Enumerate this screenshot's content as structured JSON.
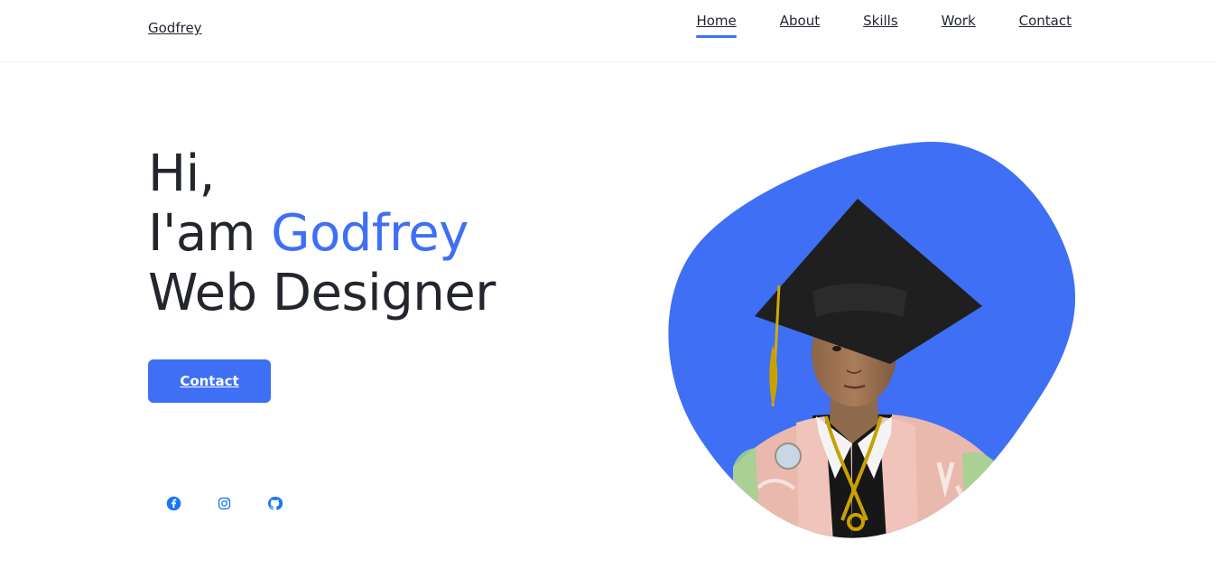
{
  "header": {
    "logo": "Godfrey",
    "nav": [
      {
        "label": "Home",
        "active": true
      },
      {
        "label": "About",
        "active": false
      },
      {
        "label": "Skills",
        "active": false
      },
      {
        "label": "Work",
        "active": false
      },
      {
        "label": "Contact",
        "active": false
      }
    ]
  },
  "hero": {
    "line1": "Hi,",
    "line2_prefix": "I'am ",
    "line2_name": "Godfrey",
    "line3": "Web Designer",
    "button_label": "Contact"
  },
  "social": [
    "facebook-icon",
    "instagram-icon",
    "github-icon"
  ],
  "colors": {
    "accent": "#3f6ff4",
    "text": "#23262d",
    "icon": "#1877f2"
  }
}
